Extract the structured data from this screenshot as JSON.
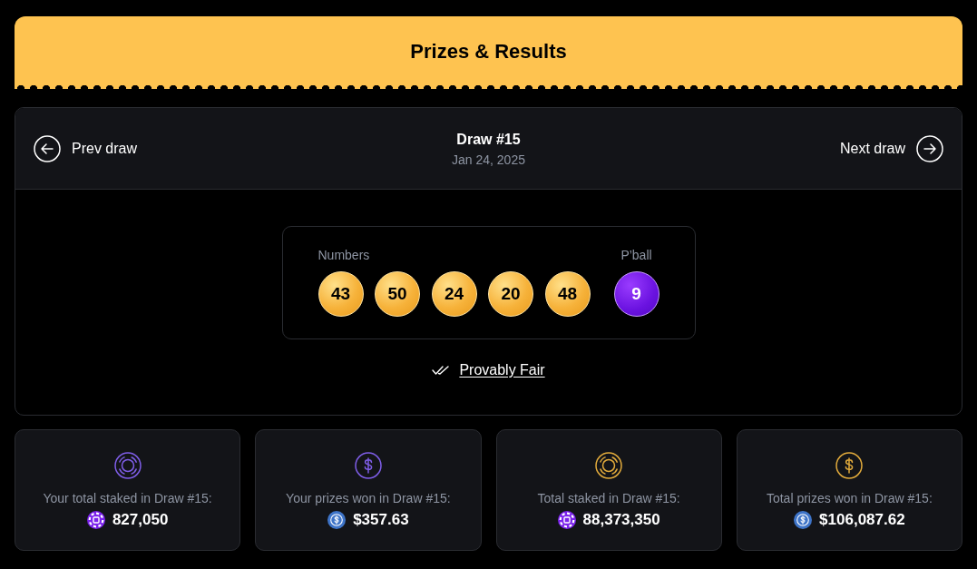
{
  "header": {
    "title": "Prizes & Results"
  },
  "draw_nav": {
    "prev": "Prev draw",
    "title": "Draw #15",
    "date": "Jan 24, 2025",
    "next": "Next draw"
  },
  "results": {
    "numbers_label": "Numbers",
    "numbers": [
      "43",
      "50",
      "24",
      "20",
      "48"
    ],
    "powerball_label": "P’ball",
    "powerball": "9"
  },
  "provably_fair": {
    "label": "Provably Fair"
  },
  "stats": [
    {
      "kind": "stake",
      "color": "#7f5ee8",
      "label": "Your total staked in Draw #15:",
      "value": "827,050"
    },
    {
      "kind": "prize",
      "color": "#7f5ee8",
      "label": "Your prizes won in Draw #15:",
      "value": "$357.63"
    },
    {
      "kind": "stake",
      "color": "#e2ab3c",
      "label": "Total staked in Draw #15:",
      "value": "88,373,350"
    },
    {
      "kind": "prize",
      "color": "#e2ab3c",
      "label": "Total prizes won in Draw #15:",
      "value": "$106,087.62"
    }
  ]
}
